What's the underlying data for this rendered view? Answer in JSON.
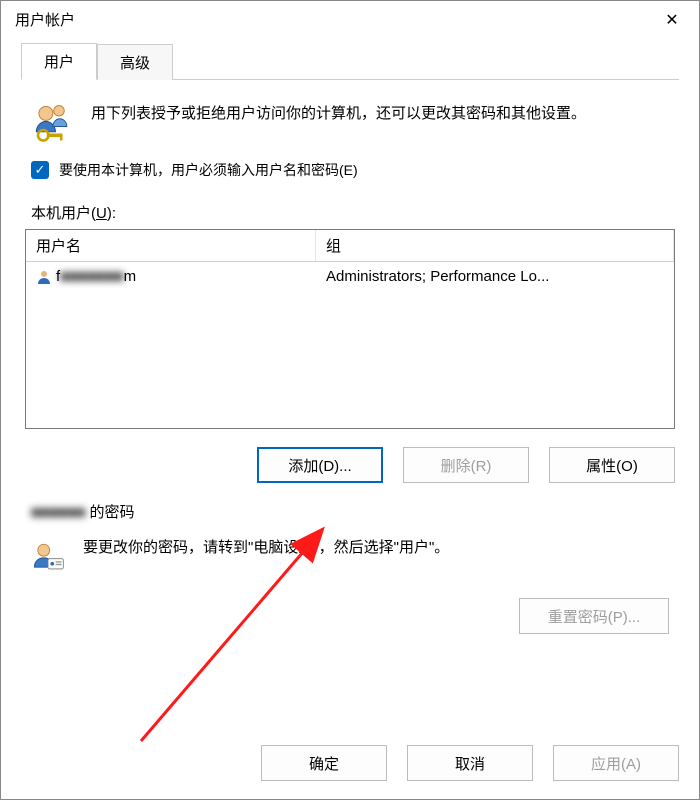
{
  "window": {
    "title": "用户帐户"
  },
  "tabs": {
    "users": "用户",
    "advanced": "高级"
  },
  "intro": "用下列表授予或拒绝用户访问你的计算机，还可以更改其密码和其他设置。",
  "checkbox": {
    "label": "要使用本计算机，用户必须输入用户名和密码(E)",
    "checked": true
  },
  "list": {
    "label_prefix": "本机用户(",
    "label_hot": "U",
    "label_suffix": "):",
    "columns": {
      "user": "用户名",
      "group": "组"
    },
    "rows": [
      {
        "username_pre": "f",
        "username_blur": "■■■■■■■",
        "username_suf": "m",
        "group": "Administrators; Performance Lo..."
      }
    ]
  },
  "buttons": {
    "add": "添加(D)...",
    "remove": "删除(R)",
    "props": "属性(O)"
  },
  "password": {
    "title_blur": "■■■■■■",
    "title_suffix": " 的密码",
    "hint": "要更改你的密码，请转到\"电脑设置\"，然后选择\"用户\"。",
    "reset": "重置密码(P)..."
  },
  "footer": {
    "ok": "确定",
    "cancel": "取消",
    "apply": "应用(A)"
  }
}
